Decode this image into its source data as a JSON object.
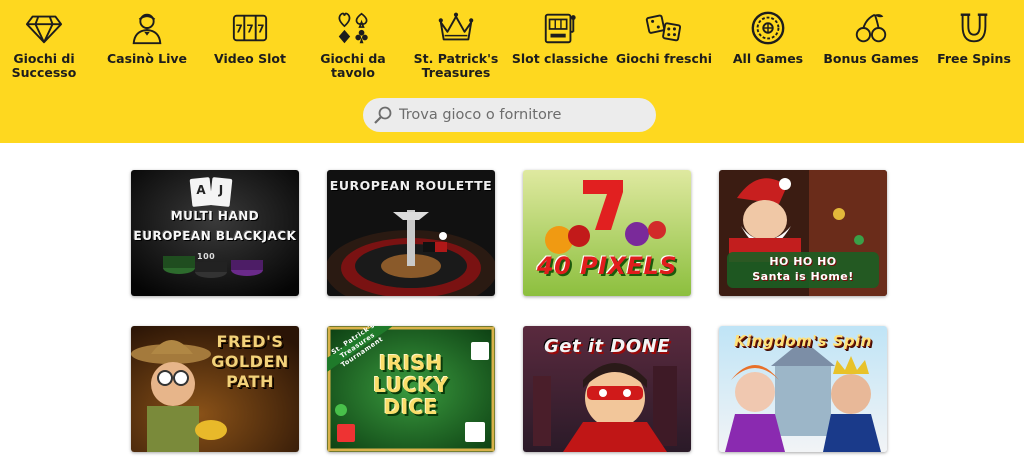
{
  "nav": {
    "items": [
      {
        "label": "Giochi di\nSuccesso",
        "icon": "diamond-icon"
      },
      {
        "label": "Casinò Live",
        "icon": "dealer-icon"
      },
      {
        "label": "Video Slot",
        "icon": "slot-777-icon"
      },
      {
        "label": "Giochi da\ntavolo",
        "icon": "card-suits-icon"
      },
      {
        "label": "St. Patrick's\nTreasures",
        "icon": "crown-icon"
      },
      {
        "label": "Slot classiche",
        "icon": "slot-machine-icon"
      },
      {
        "label": "Giochi freschi",
        "icon": "dice-icon"
      },
      {
        "label": "All Games",
        "icon": "roulette-wheel-icon"
      },
      {
        "label": "Bonus Games",
        "icon": "cherries-icon"
      },
      {
        "label": "Free Spins",
        "icon": "horseshoe-icon"
      }
    ]
  },
  "search": {
    "placeholder": "Trova gioco o fornitore"
  },
  "games": [
    {
      "title": "MULTI HAND\nEUROPEAN BLACKJACK",
      "badge": "100"
    },
    {
      "title": "EUROPEAN ROULETTE"
    },
    {
      "title": "40 PIXELS"
    },
    {
      "title": "HO HO HO\nSanta is Home!"
    },
    {
      "title": "FRED'S\nGOLDEN\nPATH"
    },
    {
      "title": "IRISH\nLUCKY\nDICE",
      "banner": "St. Patrick's\nTreasures Tournament"
    },
    {
      "title": "Get it DONE"
    },
    {
      "title": "Kingdom's Spin"
    }
  ],
  "colors": {
    "brand_yellow": "#fed81f",
    "search_bg": "#ececec",
    "text_dark": "#1d1d1d"
  }
}
